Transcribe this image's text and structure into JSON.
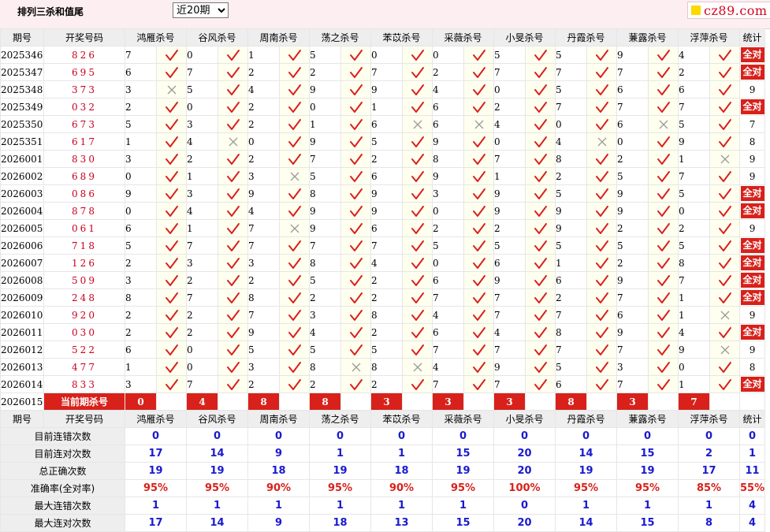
{
  "header": {
    "title": "排列三杀和值尾",
    "period_select": {
      "value": "近20期",
      "options": [
        "近20期"
      ]
    },
    "logo_text": "cz89.com"
  },
  "table": {
    "columns": [
      "期号",
      "开奖号码",
      "鸿雁杀号",
      "谷风杀号",
      "周南杀号",
      "荡之杀号",
      "苯苡杀号",
      "采薇杀号",
      "小旻杀号",
      "丹霞杀号",
      "蒹露杀号",
      "浮萍杀号",
      "统计"
    ],
    "all_correct_label": "全对",
    "rows": [
      {
        "issue": "2025346",
        "draw": "826",
        "picks": [
          [
            "7",
            true
          ],
          [
            "0",
            true
          ],
          [
            "1",
            true
          ],
          [
            "5",
            true
          ],
          [
            "0",
            true
          ],
          [
            "0",
            true
          ],
          [
            "5",
            true
          ],
          [
            "5",
            true
          ],
          [
            "9",
            true
          ],
          [
            "4",
            true
          ]
        ],
        "stat": "全对"
      },
      {
        "issue": "2025347",
        "draw": "695",
        "picks": [
          [
            "6",
            true
          ],
          [
            "7",
            true
          ],
          [
            "2",
            true
          ],
          [
            "2",
            true
          ],
          [
            "7",
            true
          ],
          [
            "2",
            true
          ],
          [
            "7",
            true
          ],
          [
            "7",
            true
          ],
          [
            "7",
            true
          ],
          [
            "2",
            true
          ]
        ],
        "stat": "全对"
      },
      {
        "issue": "2025348",
        "draw": "373",
        "picks": [
          [
            "3",
            false
          ],
          [
            "5",
            true
          ],
          [
            "4",
            true
          ],
          [
            "9",
            true
          ],
          [
            "9",
            true
          ],
          [
            "4",
            true
          ],
          [
            "0",
            true
          ],
          [
            "5",
            true
          ],
          [
            "6",
            true
          ],
          [
            "6",
            true
          ]
        ],
        "stat": "9"
      },
      {
        "issue": "2025349",
        "draw": "032",
        "picks": [
          [
            "2",
            true
          ],
          [
            "0",
            true
          ],
          [
            "2",
            true
          ],
          [
            "0",
            true
          ],
          [
            "1",
            true
          ],
          [
            "6",
            true
          ],
          [
            "2",
            true
          ],
          [
            "7",
            true
          ],
          [
            "7",
            true
          ],
          [
            "7",
            true
          ]
        ],
        "stat": "全对"
      },
      {
        "issue": "2025350",
        "draw": "673",
        "picks": [
          [
            "5",
            true
          ],
          [
            "3",
            true
          ],
          [
            "2",
            true
          ],
          [
            "1",
            true
          ],
          [
            "6",
            false
          ],
          [
            "6",
            false
          ],
          [
            "4",
            true
          ],
          [
            "0",
            true
          ],
          [
            "6",
            false
          ],
          [
            "5",
            true
          ]
        ],
        "stat": "7"
      },
      {
        "issue": "2025351",
        "draw": "617",
        "picks": [
          [
            "1",
            true
          ],
          [
            "4",
            false
          ],
          [
            "0",
            true
          ],
          [
            "9",
            true
          ],
          [
            "5",
            true
          ],
          [
            "9",
            true
          ],
          [
            "0",
            true
          ],
          [
            "4",
            false
          ],
          [
            "0",
            true
          ],
          [
            "9",
            true
          ]
        ],
        "stat": "8"
      },
      {
        "issue": "2026001",
        "draw": "830",
        "picks": [
          [
            "3",
            true
          ],
          [
            "2",
            true
          ],
          [
            "2",
            true
          ],
          [
            "7",
            true
          ],
          [
            "2",
            true
          ],
          [
            "8",
            true
          ],
          [
            "7",
            true
          ],
          [
            "8",
            true
          ],
          [
            "2",
            true
          ],
          [
            "1",
            false
          ]
        ],
        "stat": "9"
      },
      {
        "issue": "2026002",
        "draw": "689",
        "picks": [
          [
            "0",
            true
          ],
          [
            "1",
            true
          ],
          [
            "3",
            false
          ],
          [
            "5",
            true
          ],
          [
            "6",
            true
          ],
          [
            "9",
            true
          ],
          [
            "1",
            true
          ],
          [
            "2",
            true
          ],
          [
            "5",
            true
          ],
          [
            "7",
            true
          ]
        ],
        "stat": "9"
      },
      {
        "issue": "2026003",
        "draw": "086",
        "picks": [
          [
            "9",
            true
          ],
          [
            "3",
            true
          ],
          [
            "9",
            true
          ],
          [
            "8",
            true
          ],
          [
            "9",
            true
          ],
          [
            "3",
            true
          ],
          [
            "9",
            true
          ],
          [
            "5",
            true
          ],
          [
            "9",
            true
          ],
          [
            "5",
            true
          ]
        ],
        "stat": "全对"
      },
      {
        "issue": "2026004",
        "draw": "878",
        "picks": [
          [
            "0",
            true
          ],
          [
            "4",
            true
          ],
          [
            "4",
            true
          ],
          [
            "9",
            true
          ],
          [
            "9",
            true
          ],
          [
            "0",
            true
          ],
          [
            "9",
            true
          ],
          [
            "9",
            true
          ],
          [
            "9",
            true
          ],
          [
            "0",
            true
          ]
        ],
        "stat": "全对"
      },
      {
        "issue": "2026005",
        "draw": "061",
        "picks": [
          [
            "6",
            true
          ],
          [
            "1",
            true
          ],
          [
            "7",
            false
          ],
          [
            "9",
            true
          ],
          [
            "6",
            true
          ],
          [
            "2",
            true
          ],
          [
            "2",
            true
          ],
          [
            "9",
            true
          ],
          [
            "2",
            true
          ],
          [
            "2",
            true
          ]
        ],
        "stat": "9"
      },
      {
        "issue": "2026006",
        "draw": "718",
        "picks": [
          [
            "5",
            true
          ],
          [
            "7",
            true
          ],
          [
            "7",
            true
          ],
          [
            "7",
            true
          ],
          [
            "7",
            true
          ],
          [
            "5",
            true
          ],
          [
            "5",
            true
          ],
          [
            "5",
            true
          ],
          [
            "5",
            true
          ],
          [
            "5",
            true
          ]
        ],
        "stat": "全对"
      },
      {
        "issue": "2026007",
        "draw": "126",
        "picks": [
          [
            "2",
            true
          ],
          [
            "3",
            true
          ],
          [
            "3",
            true
          ],
          [
            "8",
            true
          ],
          [
            "4",
            true
          ],
          [
            "0",
            true
          ],
          [
            "6",
            true
          ],
          [
            "1",
            true
          ],
          [
            "2",
            true
          ],
          [
            "8",
            true
          ]
        ],
        "stat": "全对"
      },
      {
        "issue": "2026008",
        "draw": "509",
        "picks": [
          [
            "3",
            true
          ],
          [
            "2",
            true
          ],
          [
            "2",
            true
          ],
          [
            "5",
            true
          ],
          [
            "2",
            true
          ],
          [
            "6",
            true
          ],
          [
            "9",
            true
          ],
          [
            "6",
            true
          ],
          [
            "9",
            true
          ],
          [
            "7",
            true
          ]
        ],
        "stat": "全对"
      },
      {
        "issue": "2026009",
        "draw": "248",
        "picks": [
          [
            "8",
            true
          ],
          [
            "7",
            true
          ],
          [
            "8",
            true
          ],
          [
            "2",
            true
          ],
          [
            "2",
            true
          ],
          [
            "7",
            true
          ],
          [
            "7",
            true
          ],
          [
            "2",
            true
          ],
          [
            "7",
            true
          ],
          [
            "1",
            true
          ]
        ],
        "stat": "全对"
      },
      {
        "issue": "2026010",
        "draw": "920",
        "picks": [
          [
            "2",
            true
          ],
          [
            "2",
            true
          ],
          [
            "7",
            true
          ],
          [
            "3",
            true
          ],
          [
            "8",
            true
          ],
          [
            "4",
            true
          ],
          [
            "7",
            true
          ],
          [
            "7",
            true
          ],
          [
            "6",
            true
          ],
          [
            "1",
            false
          ]
        ],
        "stat": "9"
      },
      {
        "issue": "2026011",
        "draw": "030",
        "picks": [
          [
            "2",
            true
          ],
          [
            "2",
            true
          ],
          [
            "9",
            true
          ],
          [
            "4",
            true
          ],
          [
            "2",
            true
          ],
          [
            "6",
            true
          ],
          [
            "4",
            true
          ],
          [
            "8",
            true
          ],
          [
            "9",
            true
          ],
          [
            "4",
            true
          ]
        ],
        "stat": "全对"
      },
      {
        "issue": "2026012",
        "draw": "522",
        "picks": [
          [
            "6",
            true
          ],
          [
            "0",
            true
          ],
          [
            "5",
            true
          ],
          [
            "5",
            true
          ],
          [
            "5",
            true
          ],
          [
            "7",
            true
          ],
          [
            "7",
            true
          ],
          [
            "7",
            true
          ],
          [
            "7",
            true
          ],
          [
            "9",
            false
          ]
        ],
        "stat": "9"
      },
      {
        "issue": "2026013",
        "draw": "477",
        "picks": [
          [
            "1",
            true
          ],
          [
            "0",
            true
          ],
          [
            "3",
            true
          ],
          [
            "8",
            false
          ],
          [
            "8",
            false
          ],
          [
            "4",
            true
          ],
          [
            "9",
            true
          ],
          [
            "5",
            true
          ],
          [
            "3",
            true
          ],
          [
            "0",
            true
          ]
        ],
        "stat": "8"
      },
      {
        "issue": "2026014",
        "draw": "833",
        "picks": [
          [
            "3",
            true
          ],
          [
            "7",
            true
          ],
          [
            "2",
            true
          ],
          [
            "2",
            true
          ],
          [
            "2",
            true
          ],
          [
            "7",
            true
          ],
          [
            "7",
            true
          ],
          [
            "6",
            true
          ],
          [
            "7",
            true
          ],
          [
            "1",
            true
          ]
        ],
        "stat": "全对"
      }
    ],
    "current": {
      "issue": "2026015",
      "label": "当前期杀号",
      "picks": [
        "0",
        "4",
        "8",
        "8",
        "3",
        "3",
        "3",
        "8",
        "3",
        "7"
      ]
    }
  },
  "summary": {
    "rows": [
      {
        "label": "目前连错次数",
        "values": [
          "0",
          "0",
          "0",
          "0",
          "0",
          "0",
          "0",
          "0",
          "0",
          "0",
          "0"
        ],
        "rate": false
      },
      {
        "label": "目前连对次数",
        "values": [
          "17",
          "14",
          "9",
          "1",
          "1",
          "15",
          "20",
          "14",
          "15",
          "2",
          "1"
        ],
        "rate": false
      },
      {
        "label": "总正确次数",
        "values": [
          "19",
          "19",
          "18",
          "19",
          "18",
          "19",
          "20",
          "19",
          "19",
          "17",
          "11"
        ],
        "rate": false
      },
      {
        "label": "准确率(全对率)",
        "values": [
          "95%",
          "95%",
          "90%",
          "95%",
          "90%",
          "95%",
          "100%",
          "95%",
          "95%",
          "85%",
          "55%"
        ],
        "rate": true
      },
      {
        "label": "最大连错次数",
        "values": [
          "1",
          "1",
          "1",
          "1",
          "1",
          "1",
          "0",
          "1",
          "1",
          "1",
          "4"
        ],
        "rate": false
      },
      {
        "label": "最大连对次数",
        "values": [
          "17",
          "14",
          "9",
          "18",
          "13",
          "15",
          "20",
          "14",
          "15",
          "8",
          "4"
        ],
        "rate": false
      }
    ]
  },
  "colors": {
    "accent": "#d8211b",
    "check": "#d8211b",
    "cross": "#9a9a9a",
    "summary_value": "#1a1ad0",
    "header_bg": "#fdeef2"
  }
}
